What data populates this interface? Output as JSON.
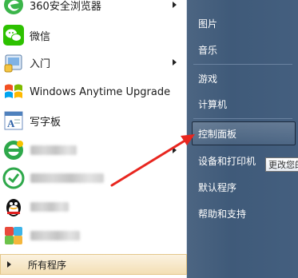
{
  "left_menu": {
    "items": [
      {
        "label": "360安全浏览器",
        "icon": "360-browser-icon",
        "has_submenu": true
      },
      {
        "label": "微信",
        "icon": "wechat-icon",
        "has_submenu": false
      },
      {
        "label": "入门",
        "icon": "getting-started-icon",
        "has_submenu": true
      },
      {
        "label": "Windows Anytime Upgrade",
        "icon": "windows-flag-icon",
        "has_submenu": false
      },
      {
        "label": "写字板",
        "icon": "wordpad-icon",
        "has_submenu": false
      },
      {
        "label": "",
        "icon": "360-security-icon",
        "has_submenu": true
      },
      {
        "label": "",
        "icon": "360-guard-icon",
        "has_submenu": false
      },
      {
        "label": "",
        "icon": "qq-penguin-icon",
        "has_submenu": false
      },
      {
        "label": "",
        "icon": "colorful-app-icon",
        "has_submenu": false
      }
    ],
    "all_programs_label": "所有程序"
  },
  "right_menu": {
    "items": [
      "图片",
      "音乐",
      "游戏",
      "计算机",
      "控制面板",
      "设备和打印机",
      "默认程序",
      "帮助和支持"
    ],
    "highlighted": "控制面板"
  },
  "tooltip": {
    "text": "更改您的"
  },
  "colors": {
    "right_pane": "#445f7f",
    "all_programs": "#f3dfb5",
    "arrow": "#e8261f"
  }
}
